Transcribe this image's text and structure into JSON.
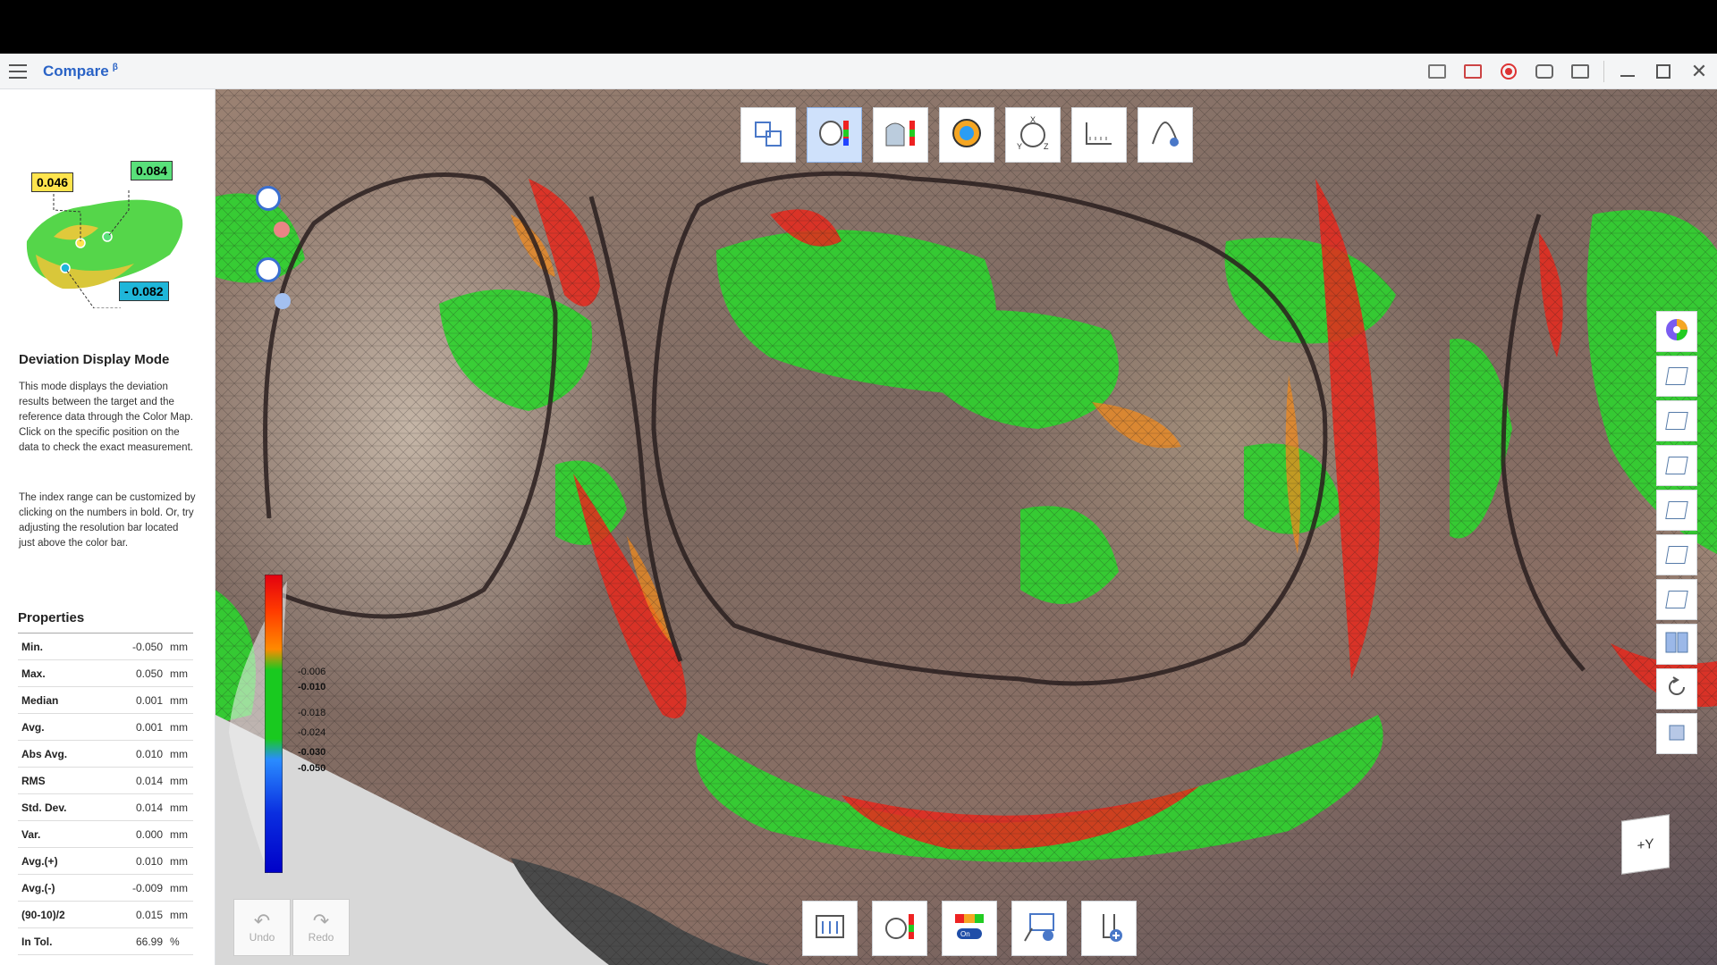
{
  "window": {
    "title": "Compare",
    "beta_mark": "β",
    "tools": [
      "screen-compare-icon",
      "screen-crop-icon",
      "record-icon",
      "camera-icon",
      "window-icon"
    ],
    "controls": [
      "minimize-icon",
      "maximize-icon",
      "close-icon"
    ]
  },
  "preview": {
    "label_top_left": "0.046",
    "label_top_right": "0.084",
    "label_bottom": "- 0.082",
    "colors": {
      "yellow": "#ffe44d",
      "green": "#59e07a",
      "cyan": "#1fb6d9"
    }
  },
  "info": {
    "title": "Deviation Display Mode",
    "paragraph1": "This mode displays the deviation results between the target and the reference data through the Color Map. Click on the specific position on the data to check the exact measurement.",
    "paragraph2": "The index range can be customized by clicking on the numbers in bold. Or, try adjusting the resolution bar located just above the color bar."
  },
  "properties": {
    "title": "Properties",
    "rows": [
      {
        "name": "Min.",
        "value": "-0.050",
        "unit": "mm"
      },
      {
        "name": "Max.",
        "value": "0.050",
        "unit": "mm"
      },
      {
        "name": "Median",
        "value": "0.001",
        "unit": "mm"
      },
      {
        "name": "Avg.",
        "value": "0.001",
        "unit": "mm"
      },
      {
        "name": "Abs Avg.",
        "value": "0.010",
        "unit": "mm"
      },
      {
        "name": "RMS",
        "value": "0.014",
        "unit": "mm"
      },
      {
        "name": "Std. Dev.",
        "value": "0.014",
        "unit": "mm"
      },
      {
        "name": "Var.",
        "value": "0.000",
        "unit": "mm"
      },
      {
        "name": "Avg.(+)",
        "value": "0.010",
        "unit": "mm"
      },
      {
        "name": "Avg.(-)",
        "value": "-0.009",
        "unit": "mm"
      },
      {
        "name": "(90-10)/2",
        "value": "0.015",
        "unit": "mm"
      },
      {
        "name": "In Tol.",
        "value": "66.99",
        "unit": "%"
      }
    ]
  },
  "colorbar": {
    "labels": [
      {
        "text": "-0.006",
        "bold": false
      },
      {
        "text": "-0.010",
        "bold": true
      },
      {
        "text": "-0.018",
        "bold": false
      },
      {
        "text": "-0.024",
        "bold": false
      },
      {
        "text": "-0.030",
        "bold": true
      },
      {
        "text": "-0.050",
        "bold": true
      }
    ]
  },
  "top_toolbar": [
    {
      "id": "align-tool",
      "icon": "align-icon",
      "active": false
    },
    {
      "id": "deviation-display",
      "icon": "deviation-colormap-icon",
      "active": true
    },
    {
      "id": "section-deviation",
      "icon": "section-chart-icon",
      "active": false
    },
    {
      "id": "occlusion-map",
      "icon": "tooth-map-icon",
      "active": false
    },
    {
      "id": "axis-view",
      "icon": "xyz-axis-icon",
      "active": false
    },
    {
      "id": "measure",
      "icon": "ruler-icon",
      "active": false
    },
    {
      "id": "clear-markers",
      "icon": "clear-marker-icon",
      "active": false
    }
  ],
  "bottom_toolbar": [
    {
      "id": "report",
      "icon": "report-icon"
    },
    {
      "id": "colormap-settings",
      "icon": "colormap-settings-icon"
    },
    {
      "id": "colorbar-toggle",
      "icon": "colorbar-toggle-icon",
      "label": "On"
    },
    {
      "id": "remove-annotations",
      "icon": "remove-annotation-icon"
    },
    {
      "id": "add-point",
      "icon": "add-point-icon"
    }
  ],
  "history": {
    "undo": "Undo",
    "redo": "Redo"
  },
  "view_cube": {
    "label": "+Y"
  },
  "right_toolbar": [
    "texture-color-icon",
    "view-front-icon",
    "view-back-icon",
    "view-left-icon",
    "view-right-icon",
    "view-top-icon",
    "view-bottom-icon",
    "split-view-icon",
    "reset-view-icon",
    "cube-view-icon"
  ]
}
